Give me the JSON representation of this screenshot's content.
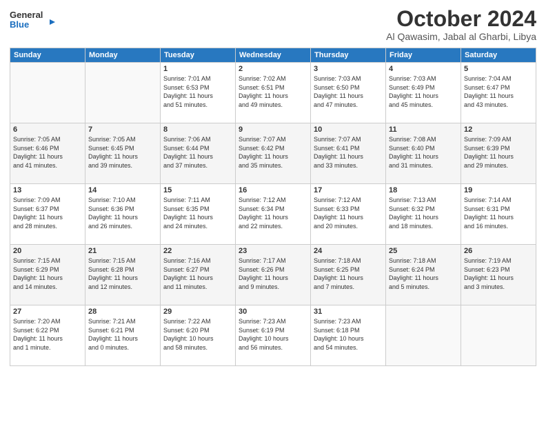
{
  "header": {
    "logo_line1": "General",
    "logo_line2": "Blue",
    "month": "October 2024",
    "location": "Al Qawasim, Jabal al Gharbi, Libya"
  },
  "days_of_week": [
    "Sunday",
    "Monday",
    "Tuesday",
    "Wednesday",
    "Thursday",
    "Friday",
    "Saturday"
  ],
  "weeks": [
    [
      {
        "day": "",
        "info": ""
      },
      {
        "day": "",
        "info": ""
      },
      {
        "day": "1",
        "info": "Sunrise: 7:01 AM\nSunset: 6:53 PM\nDaylight: 11 hours\nand 51 minutes."
      },
      {
        "day": "2",
        "info": "Sunrise: 7:02 AM\nSunset: 6:51 PM\nDaylight: 11 hours\nand 49 minutes."
      },
      {
        "day": "3",
        "info": "Sunrise: 7:03 AM\nSunset: 6:50 PM\nDaylight: 11 hours\nand 47 minutes."
      },
      {
        "day": "4",
        "info": "Sunrise: 7:03 AM\nSunset: 6:49 PM\nDaylight: 11 hours\nand 45 minutes."
      },
      {
        "day": "5",
        "info": "Sunrise: 7:04 AM\nSunset: 6:47 PM\nDaylight: 11 hours\nand 43 minutes."
      }
    ],
    [
      {
        "day": "6",
        "info": "Sunrise: 7:05 AM\nSunset: 6:46 PM\nDaylight: 11 hours\nand 41 minutes."
      },
      {
        "day": "7",
        "info": "Sunrise: 7:05 AM\nSunset: 6:45 PM\nDaylight: 11 hours\nand 39 minutes."
      },
      {
        "day": "8",
        "info": "Sunrise: 7:06 AM\nSunset: 6:44 PM\nDaylight: 11 hours\nand 37 minutes."
      },
      {
        "day": "9",
        "info": "Sunrise: 7:07 AM\nSunset: 6:42 PM\nDaylight: 11 hours\nand 35 minutes."
      },
      {
        "day": "10",
        "info": "Sunrise: 7:07 AM\nSunset: 6:41 PM\nDaylight: 11 hours\nand 33 minutes."
      },
      {
        "day": "11",
        "info": "Sunrise: 7:08 AM\nSunset: 6:40 PM\nDaylight: 11 hours\nand 31 minutes."
      },
      {
        "day": "12",
        "info": "Sunrise: 7:09 AM\nSunset: 6:39 PM\nDaylight: 11 hours\nand 29 minutes."
      }
    ],
    [
      {
        "day": "13",
        "info": "Sunrise: 7:09 AM\nSunset: 6:37 PM\nDaylight: 11 hours\nand 28 minutes."
      },
      {
        "day": "14",
        "info": "Sunrise: 7:10 AM\nSunset: 6:36 PM\nDaylight: 11 hours\nand 26 minutes."
      },
      {
        "day": "15",
        "info": "Sunrise: 7:11 AM\nSunset: 6:35 PM\nDaylight: 11 hours\nand 24 minutes."
      },
      {
        "day": "16",
        "info": "Sunrise: 7:12 AM\nSunset: 6:34 PM\nDaylight: 11 hours\nand 22 minutes."
      },
      {
        "day": "17",
        "info": "Sunrise: 7:12 AM\nSunset: 6:33 PM\nDaylight: 11 hours\nand 20 minutes."
      },
      {
        "day": "18",
        "info": "Sunrise: 7:13 AM\nSunset: 6:32 PM\nDaylight: 11 hours\nand 18 minutes."
      },
      {
        "day": "19",
        "info": "Sunrise: 7:14 AM\nSunset: 6:31 PM\nDaylight: 11 hours\nand 16 minutes."
      }
    ],
    [
      {
        "day": "20",
        "info": "Sunrise: 7:15 AM\nSunset: 6:29 PM\nDaylight: 11 hours\nand 14 minutes."
      },
      {
        "day": "21",
        "info": "Sunrise: 7:15 AM\nSunset: 6:28 PM\nDaylight: 11 hours\nand 12 minutes."
      },
      {
        "day": "22",
        "info": "Sunrise: 7:16 AM\nSunset: 6:27 PM\nDaylight: 11 hours\nand 11 minutes."
      },
      {
        "day": "23",
        "info": "Sunrise: 7:17 AM\nSunset: 6:26 PM\nDaylight: 11 hours\nand 9 minutes."
      },
      {
        "day": "24",
        "info": "Sunrise: 7:18 AM\nSunset: 6:25 PM\nDaylight: 11 hours\nand 7 minutes."
      },
      {
        "day": "25",
        "info": "Sunrise: 7:18 AM\nSunset: 6:24 PM\nDaylight: 11 hours\nand 5 minutes."
      },
      {
        "day": "26",
        "info": "Sunrise: 7:19 AM\nSunset: 6:23 PM\nDaylight: 11 hours\nand 3 minutes."
      }
    ],
    [
      {
        "day": "27",
        "info": "Sunrise: 7:20 AM\nSunset: 6:22 PM\nDaylight: 11 hours\nand 1 minute."
      },
      {
        "day": "28",
        "info": "Sunrise: 7:21 AM\nSunset: 6:21 PM\nDaylight: 11 hours\nand 0 minutes."
      },
      {
        "day": "29",
        "info": "Sunrise: 7:22 AM\nSunset: 6:20 PM\nDaylight: 10 hours\nand 58 minutes."
      },
      {
        "day": "30",
        "info": "Sunrise: 7:23 AM\nSunset: 6:19 PM\nDaylight: 10 hours\nand 56 minutes."
      },
      {
        "day": "31",
        "info": "Sunrise: 7:23 AM\nSunset: 6:18 PM\nDaylight: 10 hours\nand 54 minutes."
      },
      {
        "day": "",
        "info": ""
      },
      {
        "day": "",
        "info": ""
      }
    ]
  ]
}
